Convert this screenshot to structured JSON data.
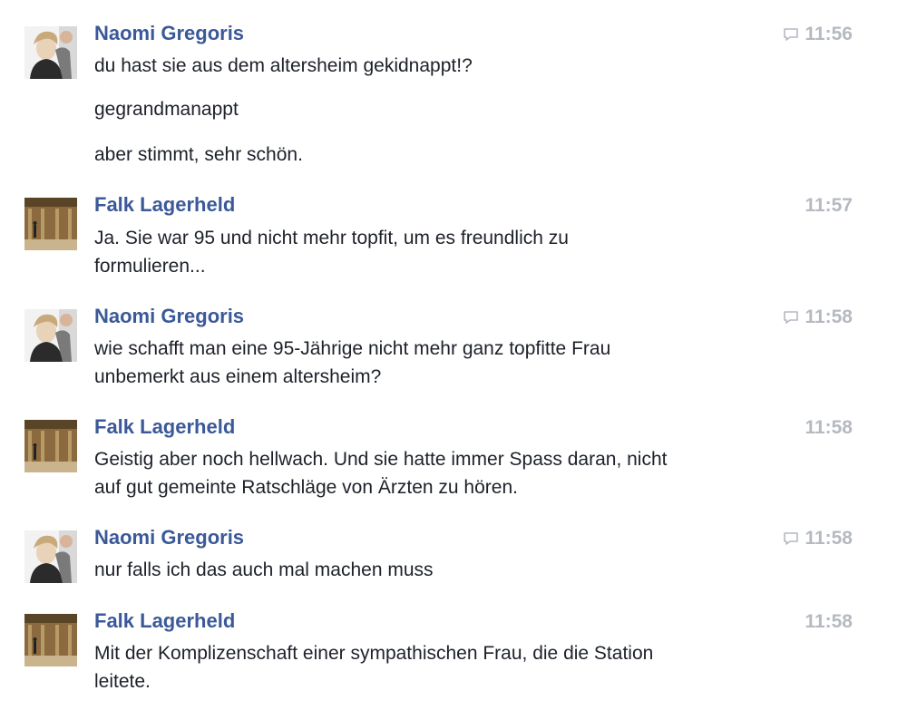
{
  "messages": [
    {
      "sender": "Naomi Gregoris",
      "avatar": "naomi-avatar",
      "time": "11:56",
      "has_reply_icon": true,
      "lines": [
        "du hast sie aus dem altersheim gekidnappt!?"
      ],
      "extra": [
        "gegrandmanappt",
        "aber stimmt, sehr schön."
      ]
    },
    {
      "sender": "Falk Lagerheld",
      "avatar": "falk-avatar",
      "time": "11:57",
      "has_reply_icon": false,
      "lines": [
        "Ja. Sie war 95 und nicht mehr topfit, um es freundlich zu",
        "formulieren..."
      ]
    },
    {
      "sender": "Naomi Gregoris",
      "avatar": "naomi-avatar",
      "time": "11:58",
      "has_reply_icon": true,
      "lines": [
        "wie schafft man eine 95-Jährige nicht mehr ganz topfitte Frau",
        "unbemerkt aus einem altersheim?"
      ]
    },
    {
      "sender": "Falk Lagerheld",
      "avatar": "falk-avatar",
      "time": "11:58",
      "has_reply_icon": false,
      "lines": [
        "Geistig aber noch hellwach. Und sie hatte immer Spass daran, nicht",
        "auf gut gemeinte Ratschläge von Ärzten zu hören."
      ]
    },
    {
      "sender": "Naomi Gregoris",
      "avatar": "naomi-avatar",
      "time": "11:58",
      "has_reply_icon": true,
      "lines": [
        "nur falls ich das auch mal machen muss"
      ]
    },
    {
      "sender": "Falk Lagerheld",
      "avatar": "falk-avatar",
      "time": "11:58",
      "has_reply_icon": false,
      "lines": [
        "Mit der Komplizenschaft einer sympathischen Frau, die die Station",
        "leitete."
      ]
    }
  ],
  "colors": {
    "sender": "#3b5998",
    "text": "#1d2129",
    "time": "#b5b9c0"
  }
}
